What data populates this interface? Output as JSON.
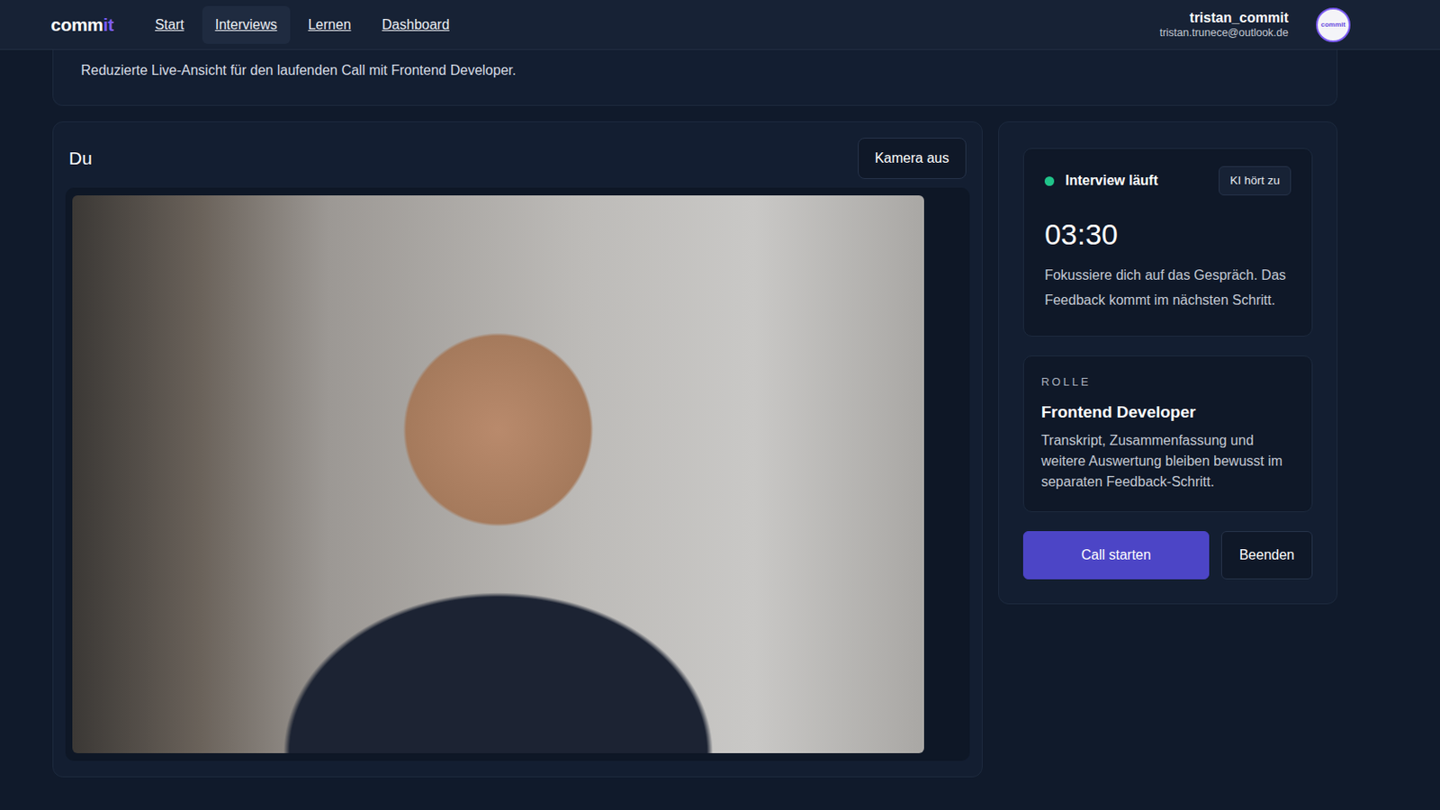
{
  "navbar": {
    "logo": {
      "prefix": "comm",
      "accent": "it"
    },
    "items": [
      {
        "label": "Start",
        "selected": false
      },
      {
        "label": "Interviews",
        "selected": true
      },
      {
        "label": "Lernen",
        "selected": false
      },
      {
        "label": "Dashboard",
        "selected": false
      }
    ],
    "user": {
      "name": "tristan_commit",
      "email": "tristan.trunece@outlook.de",
      "avatar": "commit"
    }
  },
  "intro": {
    "text": "Reduzierte Live-Ansicht für den laufenden Call mit Frontend Developer."
  },
  "camera": {
    "title": "Du",
    "toggle": "Kamera aus",
    "on": true
  },
  "status": {
    "live": true,
    "label": "Interview läuft",
    "badge": "KI hört zu",
    "timer": "03:30",
    "hint": "Fokussiere dich auf das Gespräch. Das Feedback kommt im nächsten Schritt."
  },
  "role": {
    "caption": "ROLLE",
    "title": "Frontend Developer",
    "note": "Transkript, Zusammenfassung und weitere Auswertung bleiben bewusst im separaten Feedback-Schritt."
  },
  "actions": [
    {
      "label": "Call starten",
      "kind": "primary"
    },
    {
      "label": "Beenden",
      "kind": "secondary"
    }
  ]
}
